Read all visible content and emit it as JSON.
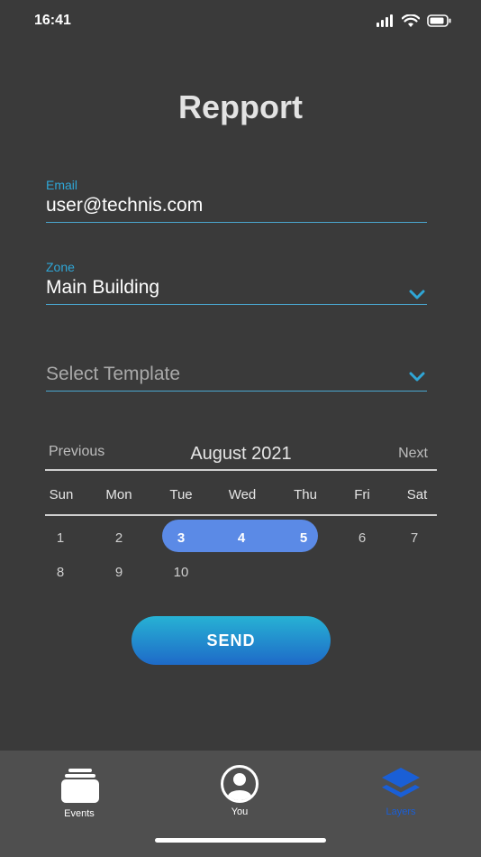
{
  "status": {
    "time": "16:41"
  },
  "page": {
    "title": "Repport"
  },
  "form": {
    "email": {
      "label": "Email",
      "value": "user@technis.com"
    },
    "zone": {
      "label": "Zone",
      "value": "Main Building"
    },
    "template": {
      "placeholder": "Select Template"
    }
  },
  "calendar": {
    "prev_label": "Previous",
    "month_label": "August 2021",
    "next_label": "Next",
    "weekdays": [
      "Sun",
      "Mon",
      "Tue",
      "Wed",
      "Thu",
      "Fri",
      "Sat"
    ],
    "week1": [
      "1",
      "2",
      "3",
      "4",
      "5",
      "6",
      "7"
    ],
    "week2": [
      "8",
      "9",
      "10"
    ],
    "selected_range": [
      "3",
      "4",
      "5"
    ]
  },
  "actions": {
    "send_label": "SEND"
  },
  "tabbar": {
    "tabs": [
      {
        "label": "Events",
        "icon": "events-icon"
      },
      {
        "label": "You",
        "icon": "user-icon"
      },
      {
        "label": "Layers",
        "icon": "layers-icon",
        "active": true
      }
    ],
    "active_color": "#1a5fd6"
  },
  "colors": {
    "accent": "#2fa6d6",
    "range": "#5b8ae6",
    "background": "#3a3a3a"
  }
}
